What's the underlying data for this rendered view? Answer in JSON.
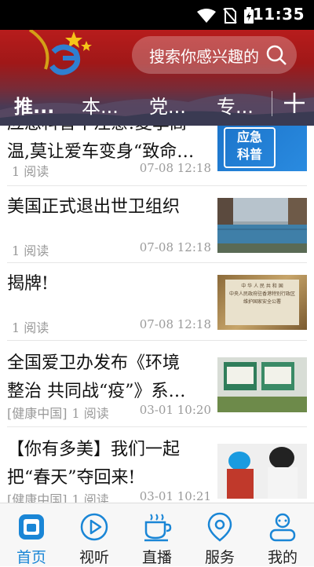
{
  "status_bar": {
    "time": "11:35"
  },
  "search": {
    "placeholder": "搜索你感兴趣的"
  },
  "tabs": [
    {
      "label": "推..."
    },
    {
      "label": "本..."
    },
    {
      "label": "党..."
    },
    {
      "label": "专..."
    }
  ],
  "news": [
    {
      "title_line1": "应急科普丨注意!夏季高",
      "title_line2": "温,莫让爱车变身“致命…",
      "source": "",
      "reads": "1 阅读",
      "time": "07-08 12:18",
      "thumb_text": [
        "应急",
        "科普"
      ]
    },
    {
      "title_line1": "美国正式退出世卫组织",
      "title_line2": "",
      "source": "",
      "reads": "1 阅读",
      "time": "07-08 12:18"
    },
    {
      "title_line1": "揭牌!",
      "title_line2": "",
      "source": "",
      "reads": "1 阅读",
      "time": "07-08 12:18",
      "thumb_text": [
        "中 华 人 民 共 和 国",
        "中央人民政府驻香港特别行政区",
        "维护国家安全公署"
      ]
    },
    {
      "title_line1": "全国爱卫办发布《环境",
      "title_line2": "整治 共同战“疫”》系…",
      "source": "[健康中国]",
      "reads": "1 阅读",
      "time": "03-01 10:20"
    },
    {
      "title_line1": "【你有多美】我们一起",
      "title_line2": "把“春天”夺回来!",
      "source": "[健康中国]",
      "reads": "1 阅读",
      "time": "03-01 10:21"
    }
  ],
  "bottom_nav": [
    {
      "label": "首页",
      "icon": "home-icon"
    },
    {
      "label": "视听",
      "icon": "play-icon"
    },
    {
      "label": "直播",
      "icon": "cup-icon"
    },
    {
      "label": "服务",
      "icon": "location-pin-icon"
    },
    {
      "label": "我的",
      "icon": "profile-icon"
    }
  ],
  "colors": {
    "header_red": "#b71c1c",
    "accent_blue": "#1a86d6"
  }
}
